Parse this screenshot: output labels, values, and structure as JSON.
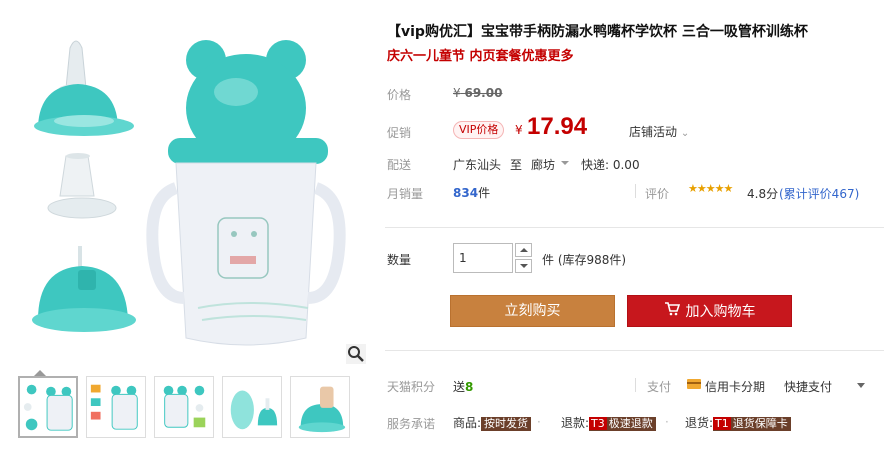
{
  "product": {
    "title": "【vip购优汇】宝宝带手柄防漏水鸭嘴杯学饮杯 三合一吸管杯训练杯",
    "promo": "庆六一儿童节 内页套餐优惠更多"
  },
  "price": {
    "label": "价格",
    "currency": "¥",
    "original": "69.00",
    "promo_label": "促销",
    "vip_tag": "VIP价格",
    "sale_currency": "¥",
    "sale": "17.94",
    "store_activity": "店铺活动"
  },
  "shipping": {
    "label": "配送",
    "from": "广东汕头",
    "to_sep": "至",
    "to": "廊坊",
    "fee": "快递: 0.00"
  },
  "sales": {
    "label": "月销量",
    "count": "834",
    "unit": "件",
    "rating_label": "评价",
    "stars": "★★★★★",
    "rating": "4.8分",
    "rating_count": "(累计评价467)"
  },
  "quantity": {
    "label": "数量",
    "value": "1",
    "unit_stock": "件 (库存988件)"
  },
  "buttons": {
    "buy_now": "立刻购买",
    "add_cart": "加入购物车"
  },
  "points": {
    "label": "天猫积分",
    "prefix": "送",
    "value": "8"
  },
  "payment": {
    "label": "支付",
    "card": "信用卡分期",
    "quick": "快捷支付"
  },
  "service": {
    "label": "服务承诺",
    "items": [
      {
        "prefix": "商品:",
        "tag": "按时发货",
        "code": ""
      },
      {
        "prefix": "退款:",
        "tag": "极速退款",
        "code": "T3"
      },
      {
        "prefix": "退货:",
        "tag": "退货保障卡",
        "code": "T1"
      }
    ]
  },
  "colors": {
    "price_red": "#c40000",
    "buy_button": "#c8813e",
    "cart_button": "#c7171d",
    "cup_teal": "#3ec7c0",
    "link_blue": "#3366cc"
  },
  "icons": [
    "zoom-icon",
    "cart-icon",
    "credit-card-icon",
    "chevron-down-icon",
    "star-icon"
  ]
}
